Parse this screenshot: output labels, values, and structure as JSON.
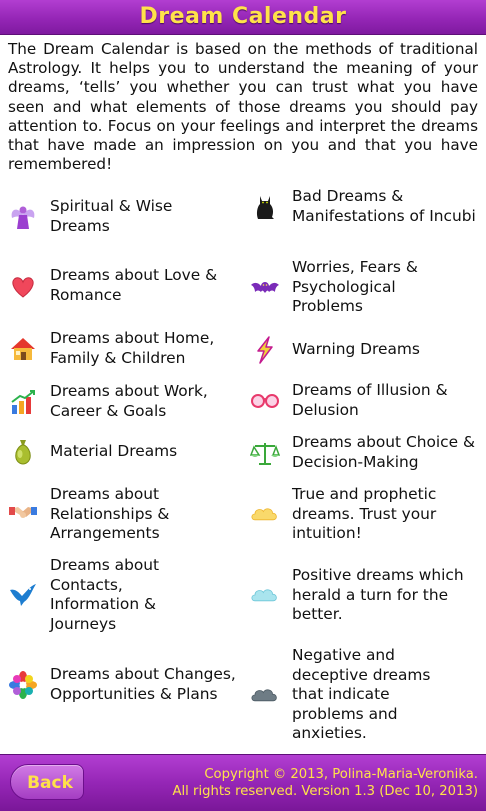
{
  "header": {
    "title": "Dream Calendar"
  },
  "intro": "The Dream Calendar is based on the methods of traditional Astrology. It helps you to understand the meaning of your dreams, ‘tells’ you whether you can trust what you have seen and what elements of those dreams you should pay attention to. Focus on your feelings and interpret the dreams that have made an impression on you and that you have remembered!",
  "categories": {
    "left": [
      {
        "label": "Spiritual & Wise Dreams",
        "icon": "angel-icon"
      },
      {
        "label": "Dreams about Love & Romance",
        "icon": "heart-icon"
      },
      {
        "label": "Dreams about Home, Family & Children",
        "icon": "house-icon"
      },
      {
        "label": "Dreams about Work, Career & Goals",
        "icon": "chart-icon"
      },
      {
        "label": "Material Dreams",
        "icon": "money-bag-icon"
      },
      {
        "label": "Dreams about Relationships & Arrangements",
        "icon": "handshake-icon"
      },
      {
        "label": "Dreams about Contacts, Information & Journeys",
        "icon": "bird-icon"
      },
      {
        "label": "Dreams about Changes, Opportunities & Plans",
        "icon": "flower-icon"
      }
    ],
    "right": [
      {
        "label": "Bad Dreams & Manifestations of Incubi",
        "icon": "cat-icon"
      },
      {
        "label": "Worries, Fears & Psychological Problems",
        "icon": "bat-icon"
      },
      {
        "label": "Warning Dreams",
        "icon": "lightning-icon"
      },
      {
        "label": "Dreams of Illusion & Delusion",
        "icon": "glasses-icon"
      },
      {
        "label": "Dreams about Choice & Decision-Making",
        "icon": "scales-icon"
      },
      {
        "label": "True and prophetic dreams. Trust your intuition!",
        "icon": "golden-cloud-icon"
      },
      {
        "label": "Positive dreams which herald a turn for the better.",
        "icon": "blue-cloud-icon"
      },
      {
        "label": "Negative and deceptive dreams that indicate problems and anxieties.",
        "icon": "dark-cloud-icon"
      }
    ]
  },
  "footer": {
    "back_label": "Back",
    "copyright_line1": "Copyright © 2013, Polina-Maria-Veronika.",
    "copyright_line2": "All rights reserved. Version 1.3 (Dec 10, 2013)"
  }
}
